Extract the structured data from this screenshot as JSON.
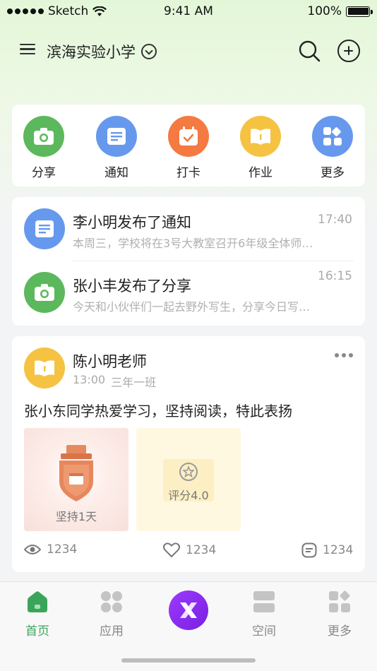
{
  "status_bar": {
    "carrier": "Sketch",
    "time": "9:41 AM",
    "battery": "100%",
    "battery_level": 1.0
  },
  "header": {
    "school_name": "滨海实验小学",
    "icons": [
      "menu-icon",
      "chevron-down-icon",
      "search-icon",
      "add-icon"
    ]
  },
  "quick_actions": [
    {
      "label": "分享",
      "icon": "camera-icon",
      "color": "#5cb85c"
    },
    {
      "label": "通知",
      "icon": "notice-icon",
      "color": "#6699ee"
    },
    {
      "label": "打卡",
      "icon": "calendar-check-icon",
      "color": "#f47a42"
    },
    {
      "label": "作业",
      "icon": "book-icon",
      "color": "#f5c242"
    },
    {
      "label": "更多",
      "icon": "apps-icon",
      "color": "#6699ee"
    }
  ],
  "notices": [
    {
      "title": "李小明发布了通知",
      "time": "17:40",
      "desc": "本周三，学校将在3号大教室召开6年级全体师…",
      "icon": "notice-icon",
      "color": "#6699ee"
    },
    {
      "title": "张小丰发布了分享",
      "time": "16:15",
      "desc": "今天和小伙伴们一起去野外写生，分享今日写…",
      "icon": "camera-icon",
      "color": "#5cb85c"
    }
  ],
  "post": {
    "author": "陈小明老师",
    "time": "13:00",
    "class": "三年一班",
    "text": "张小东同学热爱学习，坚持阅读，特此表扬",
    "images": [
      {
        "label": "坚持1天",
        "icon": "medal-icon"
      },
      {
        "label": "评分4.0",
        "icon": "star-badge-icon"
      }
    ],
    "stats": {
      "views": "1234",
      "likes": "1234",
      "comments": "1234"
    }
  },
  "tabbar": {
    "tabs": [
      {
        "label": "首页",
        "icon": "home-icon",
        "active": true
      },
      {
        "label": "应用",
        "icon": "apps-icon",
        "active": false
      },
      {
        "label": "空间",
        "icon": "space-icon",
        "active": false
      },
      {
        "label": "更多",
        "icon": "more-icon",
        "active": false
      }
    ],
    "center_icon": "x-logo-icon"
  },
  "colors": {
    "accent": "#3aa55a",
    "center_button": "#8a2ef0"
  }
}
